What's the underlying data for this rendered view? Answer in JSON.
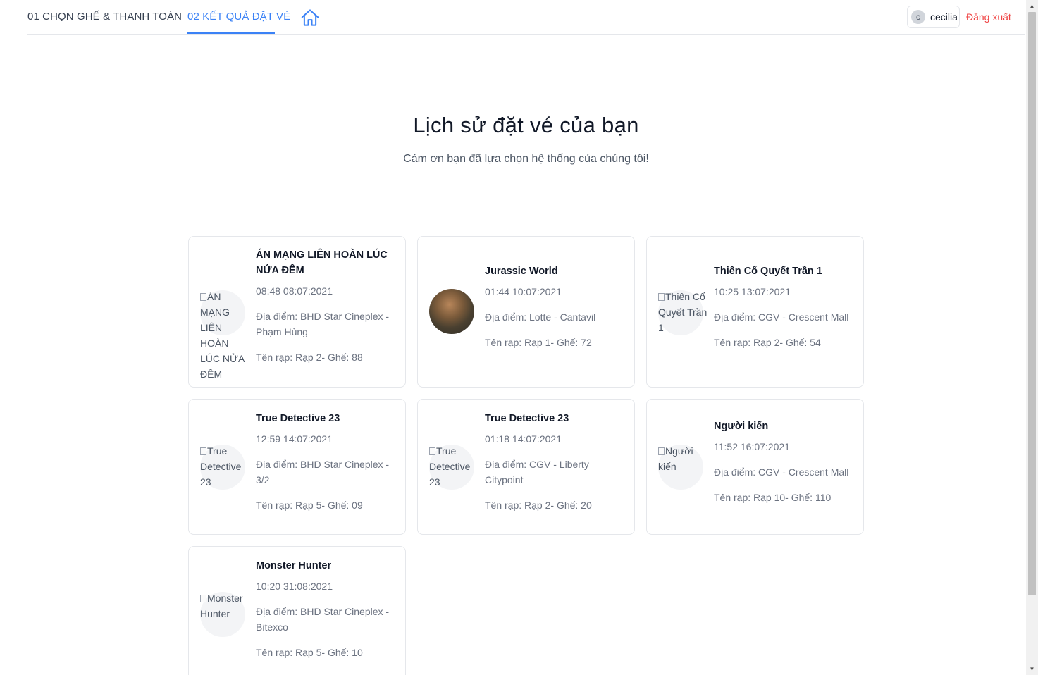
{
  "header": {
    "tabs": [
      {
        "label": "01 CHỌN GHẾ & THANH TOÁN",
        "active": false
      },
      {
        "label": "02 KẾT QUẢ ĐẶT VÉ",
        "active": true
      }
    ],
    "home_icon": "home-icon",
    "user": {
      "avatar_letter": "c",
      "name": "cecilia"
    },
    "logout_label": "Đăng xuất"
  },
  "main": {
    "title": "Lịch sử đặt vé của bạn",
    "subtitle": "Cám ơn bạn đã lựa chọn hệ thống của chúng tôi!"
  },
  "tickets": [
    {
      "movie": "ÁN MẠNG LIÊN HOÀN LÚC NỬA ĐÊM",
      "image_alt": "ÁN MẠNG LIÊN HOÀN LÚC NỬA ĐÊM",
      "time": "08:48 08:07:2021",
      "location": "Địa điểm: BHD Star Cineplex - Phạm Hùng",
      "seat": "Tên rạp: Rạp 2- Ghế: 88"
    },
    {
      "movie": "Jurassic World",
      "image_alt": "",
      "time": "01:44 10:07:2021",
      "location": "Địa điểm: Lotte - Cantavil",
      "seat": "Tên rạp: Rạp 1- Ghế: 72"
    },
    {
      "movie": "Thiên Cổ Quyết Trần 1",
      "image_alt": "Thiên Cổ Quyết Trần 1",
      "time": "10:25 13:07:2021",
      "location": "Địa điểm: CGV - Crescent Mall",
      "seat": "Tên rạp: Rạp 2- Ghế: 54"
    },
    {
      "movie": "True Detective 23",
      "image_alt": "True Detective 23",
      "time": "12:59 14:07:2021",
      "location": "Địa điểm: BHD Star Cineplex - 3/2",
      "seat": "Tên rạp: Rạp 5- Ghế: 09"
    },
    {
      "movie": "True Detective 23",
      "image_alt": "True Detective 23",
      "time": "01:18 14:07:2021",
      "location": "Địa điểm: CGV - Liberty Citypoint",
      "seat": "Tên rạp: Rạp 2- Ghế: 20"
    },
    {
      "movie": "Người kiến",
      "image_alt": "Người kiến",
      "time": "11:52 16:07:2021",
      "location": "Địa điểm: CGV - Crescent Mall",
      "seat": "Tên rạp: Rạp 10- Ghế: 110"
    },
    {
      "movie": "Monster Hunter",
      "image_alt": "Monster Hunter",
      "time": "10:20 31:08:2021",
      "location": "Địa điểm: BHD Star Cineplex - Bitexco",
      "seat": "Tên rạp: Rạp 5- Ghế: 10"
    }
  ],
  "colors": {
    "accent": "#3b82f6",
    "logout": "#ef4444"
  }
}
